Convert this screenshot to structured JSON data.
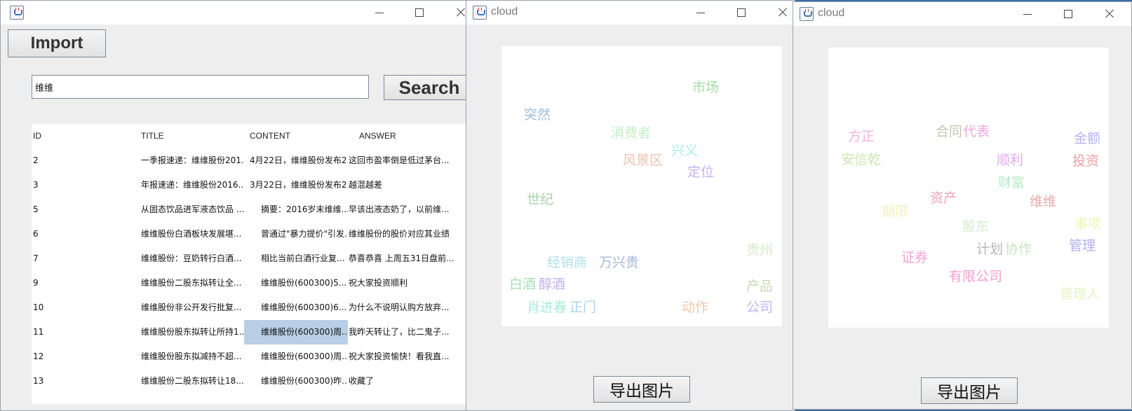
{
  "main_window": {
    "title": "",
    "import_label": "Import",
    "search": {
      "value": "维维",
      "button_label": "Search"
    },
    "table": {
      "columns": [
        "ID",
        "TITLE",
        "CONTENT",
        "ANSWER"
      ],
      "rows": [
        [
          "2",
          "一季报速递：维维股份201...",
          "4月22日，维维股份发布2...",
          "这回市盈率倒是低过茅台..."
        ],
        [
          "3",
          "年报速递：维维股份2016...",
          "3月22日，维维股份发布2...",
          "越混越差"
        ],
        [
          "5",
          "从固态饮品进军液态饮品 ...",
          "摘要：2016岁末维维...",
          "早该出液态奶了，以前维..."
        ],
        [
          "6",
          "维维股份白酒板块发展堪...",
          "曾通过\"暴力提价\"引发...",
          "维维股份的股价对应其业绩"
        ],
        [
          "7",
          "维维股份：豆奶转行白酒...",
          "相比当前白酒行业复...",
          "恭喜恭喜 上周五31日盘前..."
        ],
        [
          "9",
          "维维股份二股东拟转让全...",
          "维维股份(600300)5...",
          "祝大家投资顺利"
        ],
        [
          "10",
          "维维股份非公开发行批复...",
          "维维股份(600300)6...",
          "为什么不说明认购方放弃..."
        ],
        [
          "11",
          "维维股份股东拟转让所持1...",
          "维维股份(600300)周...",
          "我昨天转让了，比二鬼子..."
        ],
        [
          "12",
          "维维股份股东拟减持不超...",
          "维维股份(600300)周...",
          "祝大家投资愉快！看我直..."
        ],
        [
          "13",
          "维维股份二股东拟转让18....",
          "维维股份(600300)昨...",
          "收藏了"
        ]
      ],
      "selected_row": 7,
      "selected_column": 2
    }
  },
  "cloud_window_1": {
    "title": "cloud",
    "export_label": "导出图片",
    "words": [
      {
        "text": "市场",
        "color": "#a6dba4"
      },
      {
        "text": "突然",
        "color": "#9dbde4"
      },
      {
        "text": "消费者",
        "color": "#c3eec6"
      },
      {
        "text": "兴义",
        "color": "#a6f1e3"
      },
      {
        "text": "风景区",
        "color": "#f0bfae"
      },
      {
        "text": "定位",
        "color": "#c3b3f4"
      },
      {
        "text": "世纪",
        "color": "#a9d2a7"
      },
      {
        "text": "贵州",
        "color": "#d4ecc4"
      },
      {
        "text": "经销商",
        "color": "#aee1e8"
      },
      {
        "text": "万兴贵",
        "color": "#a4b6dd"
      },
      {
        "text": "白酒",
        "color": "#a6deb4"
      },
      {
        "text": "醇酒",
        "color": "#bfb0ee"
      },
      {
        "text": "产品",
        "color": "#c8dab4"
      },
      {
        "text": "肖进春",
        "color": "#a7ecd9"
      },
      {
        "text": "正门",
        "color": "#a9d3ee"
      },
      {
        "text": "动作",
        "color": "#f0c7a8"
      },
      {
        "text": "公司",
        "color": "#b8b9f4"
      }
    ]
  },
  "cloud_window_2": {
    "title": "cloud",
    "export_label": "导出图片",
    "words": [
      {
        "text": "方正",
        "color": "#f4b1e0"
      },
      {
        "text": "合同",
        "color": "#c4c4b2"
      },
      {
        "text": "代表",
        "color": "#f0a7dc"
      },
      {
        "text": "金额",
        "color": "#b8b3f5"
      },
      {
        "text": "安信乾",
        "color": "#cde7b2"
      },
      {
        "text": "顺利",
        "color": "#e2a9ef"
      },
      {
        "text": "投资",
        "color": "#eaa1a7"
      },
      {
        "text": "财富",
        "color": "#b4ecc6"
      },
      {
        "text": "资产",
        "color": "#f3a2b4"
      },
      {
        "text": "维维",
        "color": "#eeaaa7"
      },
      {
        "text": "期限",
        "color": "#f3f0bd"
      },
      {
        "text": "股东",
        "color": "#d6edc8"
      },
      {
        "text": "事项",
        "color": "#ecf4b4"
      },
      {
        "text": "管理",
        "color": "#b3aef0"
      },
      {
        "text": "计划",
        "color": "#b7b7b7"
      },
      {
        "text": "协作",
        "color": "#c9e6c0"
      },
      {
        "text": "证券",
        "color": "#f1a5cf"
      },
      {
        "text": "有限公司",
        "color": "#f0a0d0"
      },
      {
        "text": "管理人",
        "color": "#e6f3c2"
      }
    ]
  }
}
